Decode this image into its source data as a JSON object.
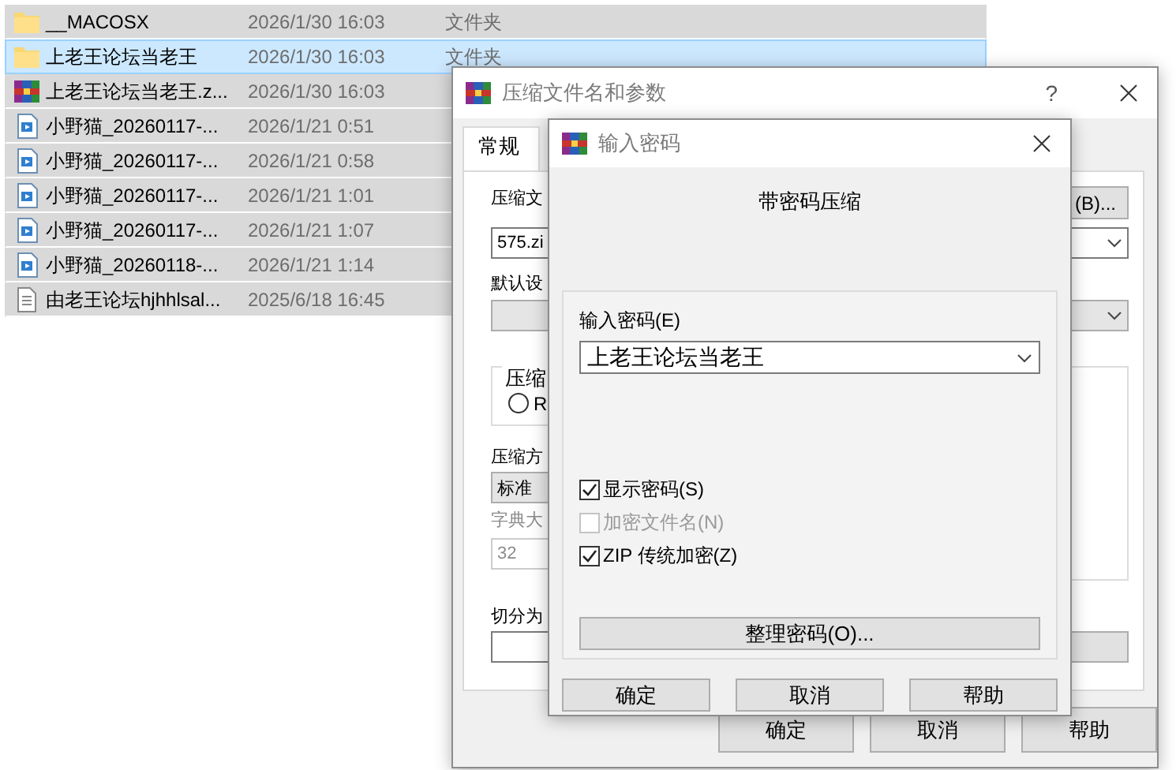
{
  "file_list": {
    "rows": [
      {
        "kind": "folder",
        "name": "__MACOSX",
        "modified": "2026/1/30 16:03",
        "type": "文件夹",
        "selected": false
      },
      {
        "kind": "folder",
        "name": "上老王论坛当老王",
        "modified": "2026/1/30 16:03",
        "type": "文件夹",
        "selected": true
      },
      {
        "kind": "archive",
        "name": "上老王论坛当老王.z...",
        "modified": "2026/1/30 16:03",
        "selected": false
      },
      {
        "kind": "video",
        "name": "小野猫_20260117-...",
        "modified": "2026/1/21 0:51",
        "selected": false
      },
      {
        "kind": "video",
        "name": "小野猫_20260117-...",
        "modified": "2026/1/21 0:58",
        "selected": false
      },
      {
        "kind": "video",
        "name": "小野猫_20260117-...",
        "modified": "2026/1/21 1:01",
        "selected": false
      },
      {
        "kind": "video",
        "name": "小野猫_20260117-...",
        "modified": "2026/1/21 1:07",
        "selected": false
      },
      {
        "kind": "video",
        "name": "小野猫_20260118-...",
        "modified": "2026/1/21 1:14",
        "selected": false
      },
      {
        "kind": "text",
        "name": "由老王论坛hjhhlsal...",
        "modified": "2025/6/18 16:45",
        "selected": false
      }
    ]
  },
  "archive_dialog": {
    "title": "压缩文件名和参数",
    "help": "?",
    "tabs": [
      {
        "label": "常规",
        "selected": true
      }
    ],
    "archive_name_label": "压缩文",
    "archive_name_value": "575.zi",
    "browse_button": "(B)...",
    "profile_label": "默认设",
    "format_group_label": "压缩",
    "format_radio": {
      "label": "R",
      "selected": false
    },
    "method_label": "压缩方",
    "method_value": "标准",
    "dictionary_label": "字典大",
    "dictionary_value": "32",
    "split_label": "切分为",
    "buttons": [
      "确定",
      "取消",
      "帮助"
    ]
  },
  "password_dialog": {
    "title": "输入密码",
    "heading": "带密码压缩",
    "password_label": "输入密码(E)",
    "password_value": "上老王论坛当老王",
    "options": [
      {
        "label": "显示密码(S)",
        "checked": true,
        "disabled": false
      },
      {
        "label": "加密文件名(N)",
        "checked": false,
        "disabled": true
      },
      {
        "label": "ZIP 传统加密(Z)",
        "checked": true,
        "disabled": false
      }
    ],
    "organize_button": "整理密码(O)...",
    "buttons": [
      "确定",
      "取消",
      "帮助"
    ]
  }
}
